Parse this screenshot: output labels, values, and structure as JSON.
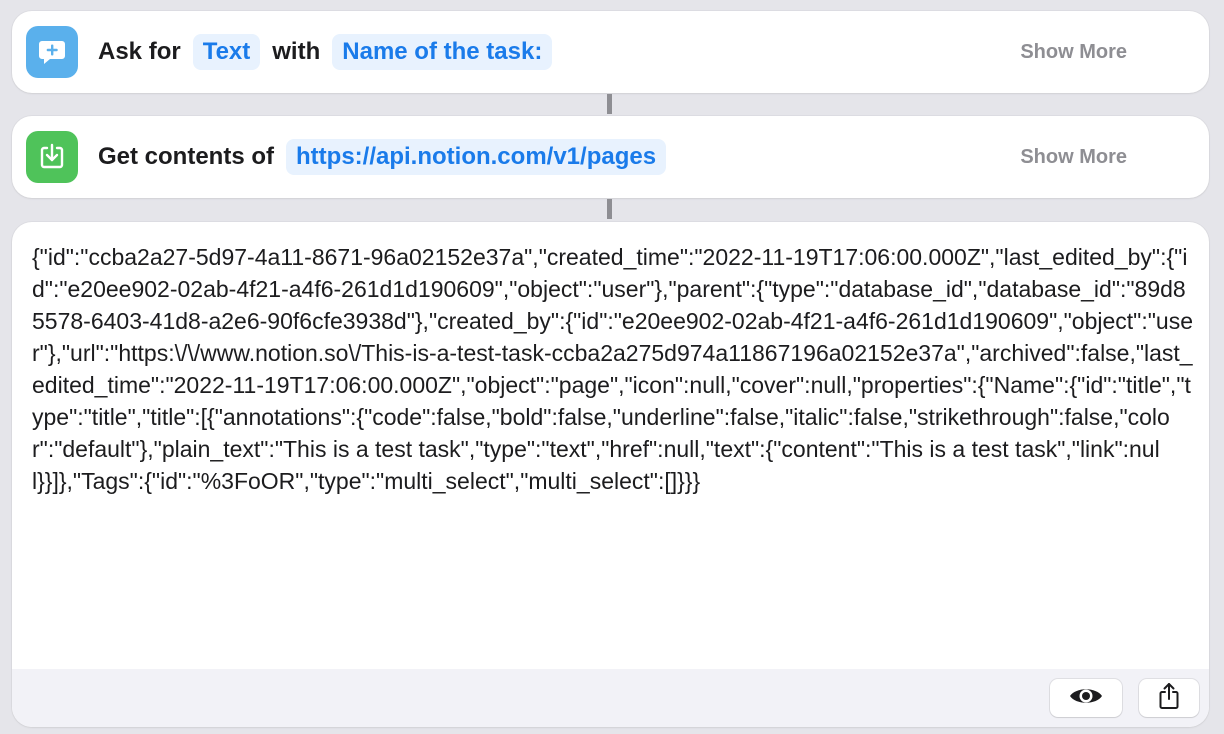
{
  "actions": {
    "ask": {
      "icon": "speech-bubble-plus-icon",
      "label": "Ask for",
      "type_token": "Text",
      "with_label": "with",
      "prompt_token": "Name of the task:",
      "show_more": "Show More"
    },
    "get": {
      "icon": "download-tray-icon",
      "label": "Get contents of",
      "url_token": "https://api.notion.com/v1/pages",
      "show_more": "Show More"
    }
  },
  "result": {
    "text": "{\"id\":\"ccba2a27-5d97-4a11-8671-96a02152e37a\",\"created_time\":\"2022-11-19T17:06:00.000Z\",\"last_edited_by\":{\"id\":\"e20ee902-02ab-4f21-a4f6-261d1d190609\",\"object\":\"user\"},\"parent\":{\"type\":\"database_id\",\"database_id\":\"89d85578-6403-41d8-a2e6-90f6cfe3938d\"},\"created_by\":{\"id\":\"e20ee902-02ab-4f21-a4f6-261d1d190609\",\"object\":\"user\"},\"url\":\"https:\\/\\/www.notion.so\\/This-is-a-test-task-ccba2a275d974a11867196a02152e37a\",\"archived\":false,\"last_edited_time\":\"2022-11-19T17:06:00.000Z\",\"object\":\"page\",\"icon\":null,\"cover\":null,\"properties\":{\"Name\":{\"id\":\"title\",\"type\":\"title\",\"title\":[{\"annotations\":{\"code\":false,\"bold\":false,\"underline\":false,\"italic\":false,\"strikethrough\":false,\"color\":\"default\"},\"plain_text\":\"This is a test task\",\"type\":\"text\",\"href\":null,\"text\":{\"content\":\"This is a test task\",\"link\":null}}]},\"Tags\":{\"id\":\"%3FoOR\",\"type\":\"multi_select\",\"multi_select\":[]}}}",
    "footer": {
      "quicklook_icon": "eye-icon",
      "share_icon": "share-icon"
    }
  },
  "colors": {
    "accent": "#1a7bea",
    "token_bg": "#e8f2fe",
    "ask_icon_bg": "#5ab0ec",
    "get_icon_bg": "#4fc35a",
    "background": "#e5e5ea"
  }
}
